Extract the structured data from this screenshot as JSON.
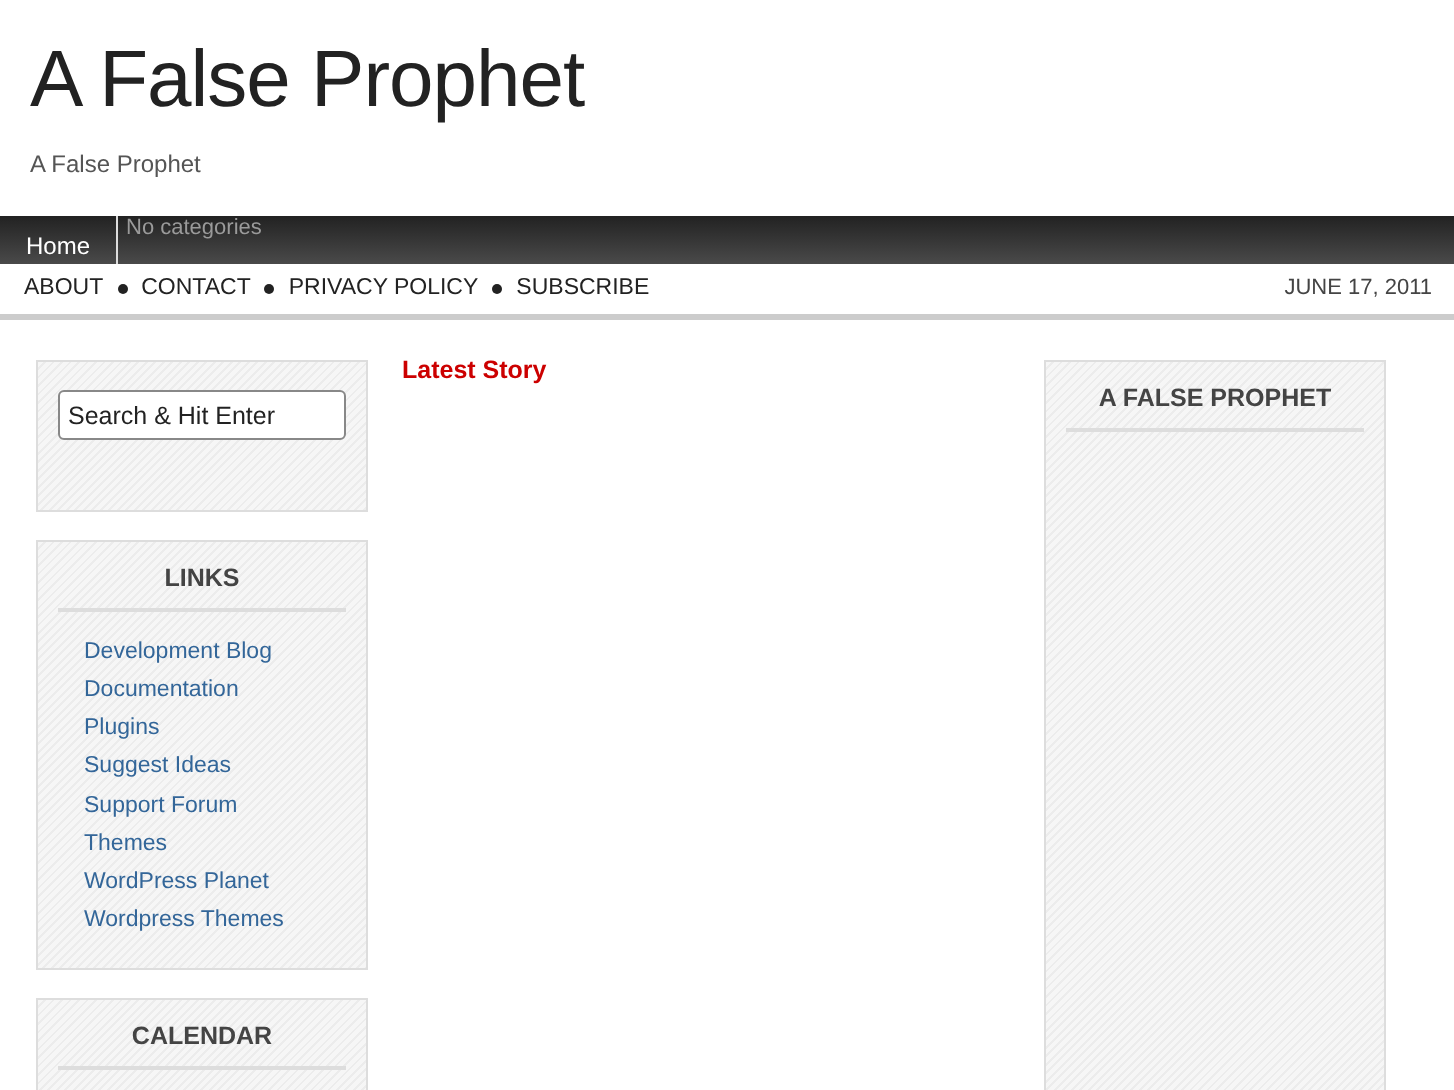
{
  "site": {
    "title": "A False Prophet",
    "tagline": "A False Prophet"
  },
  "category_bar": {
    "items": [
      {
        "label": "Home",
        "selected": false
      }
    ],
    "empty_text": "No categories"
  },
  "page_nav": {
    "items": [
      "ABOUT",
      "CONTACT",
      "PRIVACY POLICY",
      "SUBSCRIBE"
    ],
    "date": "JUNE 17, 2011"
  },
  "left_sidebar": {
    "search": {
      "placeholder": "Search & Hit Enter"
    },
    "widgets": [
      {
        "title": "LINKS",
        "links": [
          "Development Blog",
          "Documentation",
          "Plugins",
          "Suggest Ideas",
          "Support Forum",
          "Themes",
          "WordPress Planet",
          "Wordpress Themes"
        ]
      },
      {
        "title": "CALENDAR"
      }
    ]
  },
  "main": {
    "heading": "Latest Story"
  },
  "right_sidebar": {
    "widgets": [
      {
        "title": "A FALSE PROPHET"
      }
    ]
  }
}
